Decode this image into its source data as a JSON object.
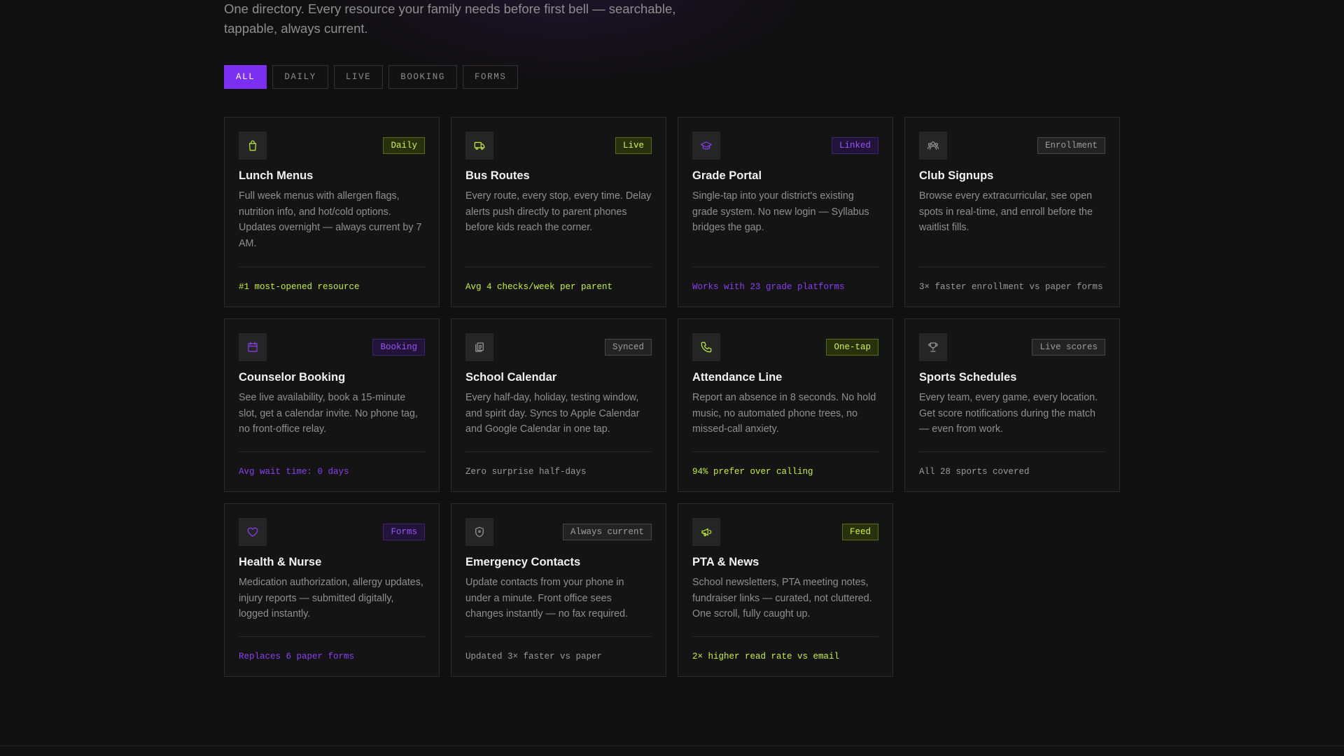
{
  "intro": {
    "text_line1": "One directory. Every resource your family needs before first bell — searchable,",
    "text_line2": "tappable, always current."
  },
  "filters": [
    {
      "label": "ALL",
      "active": true
    },
    {
      "label": "DAILY",
      "active": false
    },
    {
      "label": "LIVE",
      "active": false
    },
    {
      "label": "BOOKING",
      "active": false
    },
    {
      "label": "FORMS",
      "active": false
    }
  ],
  "colors": {
    "accent_purple": "#7b2ff0",
    "accent_lime": "#c6ef3a",
    "background": "#101010"
  },
  "cards": [
    {
      "title": "Lunch Menus",
      "icon": "shopping-bag-icon",
      "badge": "Daily",
      "tone": "lime",
      "description": "Full week menus with allergen flags, nutrition info, and hot/cold options. Updates overnight — always current by 7 AM.",
      "stat": "#1 most-opened resource"
    },
    {
      "title": "Bus Routes",
      "icon": "bus-icon",
      "badge": "Live",
      "tone": "lime",
      "description": "Every route, every stop, every time. Delay alerts push directly to parent phones before kids reach the corner.",
      "stat": "Avg 4 checks/week per parent"
    },
    {
      "title": "Grade Portal",
      "icon": "graduation-cap-icon",
      "badge": "Linked",
      "tone": "purple",
      "description": "Single-tap into your district's existing grade system. No new login — Syllabus bridges the gap.",
      "stat": "Works with 23 grade platforms"
    },
    {
      "title": "Club Signups",
      "icon": "users-icon",
      "badge": "Enrollment",
      "tone": "gray",
      "description": "Browse every extracurricular, see open spots in real-time, and enroll before the waitlist fills.",
      "stat": "3× faster enrollment vs paper forms"
    },
    {
      "title": "Counselor Booking",
      "icon": "calendar-icon",
      "badge": "Booking",
      "tone": "purple",
      "description": "See live availability, book a 15-minute slot, get a calendar invite. No phone tag, no front-office relay.",
      "stat": "Avg wait time: 0 days"
    },
    {
      "title": "School Calendar",
      "icon": "copy-icon",
      "badge": "Synced",
      "tone": "gray",
      "description": "Every half-day, holiday, testing window, and spirit day. Syncs to Apple Calendar and Google Calendar in one tap.",
      "stat": "Zero surprise half-days"
    },
    {
      "title": "Attendance Line",
      "icon": "phone-icon",
      "badge": "One-tap",
      "tone": "lime",
      "description": "Report an absence in 8 seconds. No hold music, no automated phone trees, no missed-call anxiety.",
      "stat": "94% prefer over calling"
    },
    {
      "title": "Sports Schedules",
      "icon": "trophy-icon",
      "badge": "Live scores",
      "tone": "gray",
      "description": "Every team, every game, every location. Get score notifications during the match — even from work.",
      "stat": "All 28 sports covered"
    },
    {
      "title": "Health & Nurse",
      "icon": "heart-icon",
      "badge": "Forms",
      "tone": "purple",
      "description": "Medication authorization, allergy updates, injury reports — submitted digitally, logged instantly.",
      "stat": "Replaces 6 paper forms"
    },
    {
      "title": "Emergency Contacts",
      "icon": "shield-icon",
      "badge": "Always current",
      "tone": "gray",
      "description": "Update contacts from your phone in under a minute. Front office sees changes instantly — no fax required.",
      "stat": "Updated 3× faster vs paper"
    },
    {
      "title": "PTA & News",
      "icon": "megaphone-icon",
      "badge": "Feed",
      "tone": "lime",
      "description": "School newsletters, PTA meeting notes, fundraiser links — curated, not cluttered. One scroll, fully caught up.",
      "stat": "2× higher read rate vs email"
    }
  ]
}
